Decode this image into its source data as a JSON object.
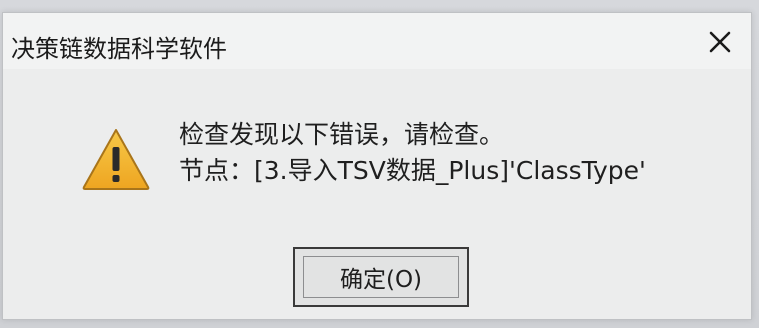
{
  "dialog": {
    "title": "决策链数据科学软件",
    "close_icon": "close-icon",
    "warning_icon": "warning-icon",
    "message_line1": "检查发现以下错误，请检查。",
    "message_line2": "节点：[3.导入TSV数据_Plus]'ClassType'",
    "ok_label": "确定(O)"
  },
  "colors": {
    "warning_fill": "#f2b534",
    "warning_stroke": "#9a6a12",
    "text": "#1f1f1f"
  }
}
